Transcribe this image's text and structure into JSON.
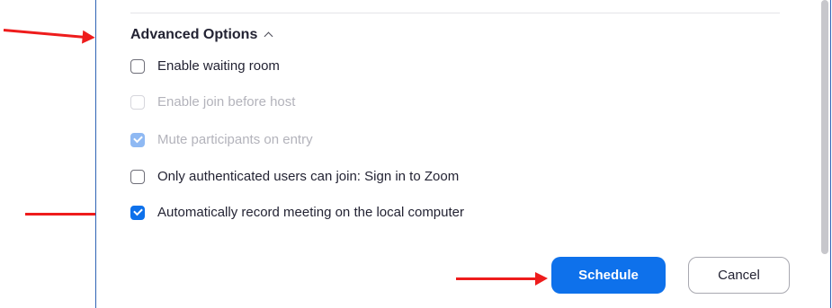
{
  "advanced_options": {
    "title": "Advanced Options",
    "expanded": true,
    "options": [
      {
        "label": "Enable waiting room",
        "checked": false,
        "disabled": false
      },
      {
        "label": "Enable join before host",
        "checked": false,
        "disabled": true
      },
      {
        "label": "Mute participants on entry",
        "checked": true,
        "disabled": true
      },
      {
        "label": "Only authenticated users can join: Sign in to Zoom",
        "checked": false,
        "disabled": false
      },
      {
        "label": "Automatically record meeting on the local computer",
        "checked": true,
        "disabled": false
      }
    ]
  },
  "buttons": {
    "schedule": "Schedule",
    "cancel": "Cancel"
  },
  "colors": {
    "accent": "#0e71eb",
    "annotation_arrow": "#ee1c1c",
    "dialog_border": "#2f64b5"
  }
}
